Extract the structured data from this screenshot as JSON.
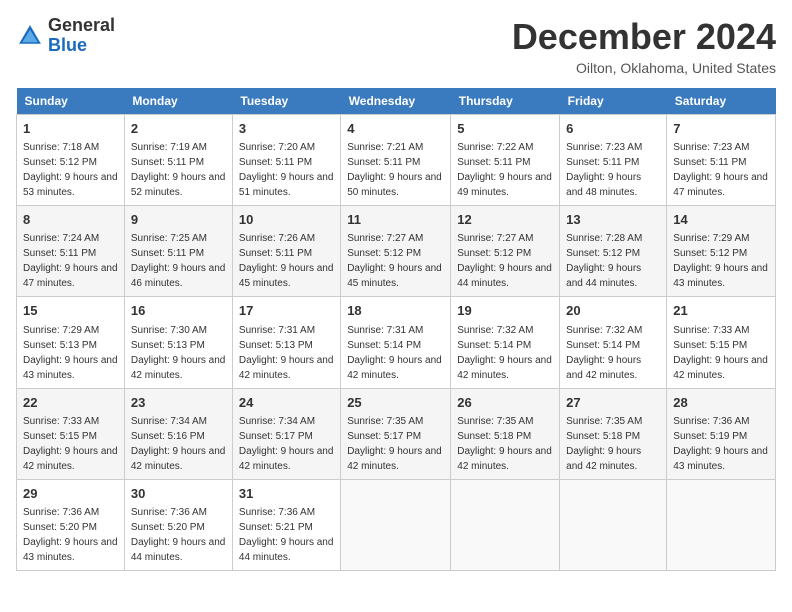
{
  "header": {
    "logo_line1": "General",
    "logo_line2": "Blue",
    "title": "December 2024",
    "subtitle": "Oilton, Oklahoma, United States"
  },
  "columns": [
    "Sunday",
    "Monday",
    "Tuesday",
    "Wednesday",
    "Thursday",
    "Friday",
    "Saturday"
  ],
  "weeks": [
    [
      {
        "day": "1",
        "sunrise": "7:18 AM",
        "sunset": "5:12 PM",
        "daylight": "9 hours and 53 minutes."
      },
      {
        "day": "2",
        "sunrise": "7:19 AM",
        "sunset": "5:11 PM",
        "daylight": "9 hours and 52 minutes."
      },
      {
        "day": "3",
        "sunrise": "7:20 AM",
        "sunset": "5:11 PM",
        "daylight": "9 hours and 51 minutes."
      },
      {
        "day": "4",
        "sunrise": "7:21 AM",
        "sunset": "5:11 PM",
        "daylight": "9 hours and 50 minutes."
      },
      {
        "day": "5",
        "sunrise": "7:22 AM",
        "sunset": "5:11 PM",
        "daylight": "9 hours and 49 minutes."
      },
      {
        "day": "6",
        "sunrise": "7:23 AM",
        "sunset": "5:11 PM",
        "daylight": "9 hours and 48 minutes."
      },
      {
        "day": "7",
        "sunrise": "7:23 AM",
        "sunset": "5:11 PM",
        "daylight": "9 hours and 47 minutes."
      }
    ],
    [
      {
        "day": "8",
        "sunrise": "7:24 AM",
        "sunset": "5:11 PM",
        "daylight": "9 hours and 47 minutes."
      },
      {
        "day": "9",
        "sunrise": "7:25 AM",
        "sunset": "5:11 PM",
        "daylight": "9 hours and 46 minutes."
      },
      {
        "day": "10",
        "sunrise": "7:26 AM",
        "sunset": "5:11 PM",
        "daylight": "9 hours and 45 minutes."
      },
      {
        "day": "11",
        "sunrise": "7:27 AM",
        "sunset": "5:12 PM",
        "daylight": "9 hours and 45 minutes."
      },
      {
        "day": "12",
        "sunrise": "7:27 AM",
        "sunset": "5:12 PM",
        "daylight": "9 hours and 44 minutes."
      },
      {
        "day": "13",
        "sunrise": "7:28 AM",
        "sunset": "5:12 PM",
        "daylight": "9 hours and 44 minutes."
      },
      {
        "day": "14",
        "sunrise": "7:29 AM",
        "sunset": "5:12 PM",
        "daylight": "9 hours and 43 minutes."
      }
    ],
    [
      {
        "day": "15",
        "sunrise": "7:29 AM",
        "sunset": "5:13 PM",
        "daylight": "9 hours and 43 minutes."
      },
      {
        "day": "16",
        "sunrise": "7:30 AM",
        "sunset": "5:13 PM",
        "daylight": "9 hours and 42 minutes."
      },
      {
        "day": "17",
        "sunrise": "7:31 AM",
        "sunset": "5:13 PM",
        "daylight": "9 hours and 42 minutes."
      },
      {
        "day": "18",
        "sunrise": "7:31 AM",
        "sunset": "5:14 PM",
        "daylight": "9 hours and 42 minutes."
      },
      {
        "day": "19",
        "sunrise": "7:32 AM",
        "sunset": "5:14 PM",
        "daylight": "9 hours and 42 minutes."
      },
      {
        "day": "20",
        "sunrise": "7:32 AM",
        "sunset": "5:14 PM",
        "daylight": "9 hours and 42 minutes."
      },
      {
        "day": "21",
        "sunrise": "7:33 AM",
        "sunset": "5:15 PM",
        "daylight": "9 hours and 42 minutes."
      }
    ],
    [
      {
        "day": "22",
        "sunrise": "7:33 AM",
        "sunset": "5:15 PM",
        "daylight": "9 hours and 42 minutes."
      },
      {
        "day": "23",
        "sunrise": "7:34 AM",
        "sunset": "5:16 PM",
        "daylight": "9 hours and 42 minutes."
      },
      {
        "day": "24",
        "sunrise": "7:34 AM",
        "sunset": "5:17 PM",
        "daylight": "9 hours and 42 minutes."
      },
      {
        "day": "25",
        "sunrise": "7:35 AM",
        "sunset": "5:17 PM",
        "daylight": "9 hours and 42 minutes."
      },
      {
        "day": "26",
        "sunrise": "7:35 AM",
        "sunset": "5:18 PM",
        "daylight": "9 hours and 42 minutes."
      },
      {
        "day": "27",
        "sunrise": "7:35 AM",
        "sunset": "5:18 PM",
        "daylight": "9 hours and 42 minutes."
      },
      {
        "day": "28",
        "sunrise": "7:36 AM",
        "sunset": "5:19 PM",
        "daylight": "9 hours and 43 minutes."
      }
    ],
    [
      {
        "day": "29",
        "sunrise": "7:36 AM",
        "sunset": "5:20 PM",
        "daylight": "9 hours and 43 minutes."
      },
      {
        "day": "30",
        "sunrise": "7:36 AM",
        "sunset": "5:20 PM",
        "daylight": "9 hours and 44 minutes."
      },
      {
        "day": "31",
        "sunrise": "7:36 AM",
        "sunset": "5:21 PM",
        "daylight": "9 hours and 44 minutes."
      },
      null,
      null,
      null,
      null
    ]
  ]
}
